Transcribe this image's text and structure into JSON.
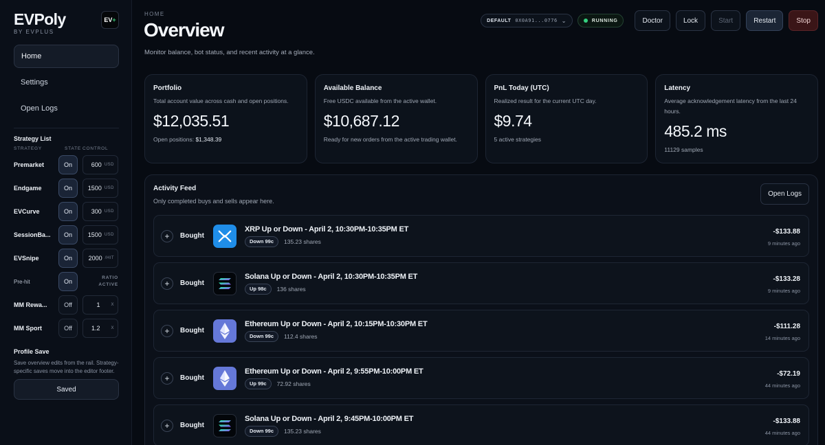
{
  "brand": {
    "title": "EVPoly",
    "subtitle": "BY EVPLUS",
    "logo_text": "EV",
    "logo_accent": "+"
  },
  "nav": [
    {
      "label": "Home",
      "active": true
    },
    {
      "label": "Settings",
      "active": false
    },
    {
      "label": "Open Logs",
      "active": false
    }
  ],
  "strategy_list": {
    "title": "Strategy List",
    "col_strategy": "STRATEGY",
    "col_state": "STATE",
    "col_control": "CONTROL",
    "rows": [
      {
        "name": "Premarket",
        "state": "On",
        "value": "600",
        "unit": "USD"
      },
      {
        "name": "Endgame",
        "state": "On",
        "value": "1500",
        "unit": "USD"
      },
      {
        "name": "EVCurve",
        "state": "On",
        "value": "300",
        "unit": "USD"
      },
      {
        "name": "SessionBa...",
        "state": "On",
        "value": "1500",
        "unit": "USD"
      },
      {
        "name": "EVSnipe",
        "state": "On",
        "value": "2000",
        "unit": "/HIT"
      },
      {
        "name": "Pre-hit",
        "state": "On",
        "ratio_label": "RATIO ACTIVE"
      },
      {
        "name": "MM Rewa...",
        "state": "Off",
        "value": "1",
        "unit": "X"
      },
      {
        "name": "MM Sport",
        "state": "Off",
        "value": "1.2",
        "unit": "X"
      }
    ]
  },
  "profile_save": {
    "title": "Profile Save",
    "description": "Save overview edits from the rail. Strategy-specific saves move into the editor footer.",
    "button": "Saved"
  },
  "header": {
    "breadcrumb": "HOME",
    "title": "Overview",
    "subtitle": "Monitor balance, bot status, and recent activity at a glance.",
    "profile_name": "DEFAULT",
    "profile_address": "0X0A91...0776",
    "status": "RUNNING",
    "buttons": {
      "doctor": "Doctor",
      "lock": "Lock",
      "start": "Start",
      "restart": "Restart",
      "stop": "Stop"
    }
  },
  "cards": {
    "portfolio": {
      "title": "Portfolio",
      "desc": "Total account value across cash and open positions.",
      "value": "$12,035.51",
      "foot_label": "Open positions:",
      "foot_value": "$1,348.39"
    },
    "balance": {
      "title": "Available Balance",
      "desc": "Free USDC available from the active wallet.",
      "value": "$10,687.12",
      "foot": "Ready for new orders from the active trading wallet."
    },
    "pnl": {
      "title": "PnL Today (UTC)",
      "desc": "Realized result for the current UTC day.",
      "value": "$9.74",
      "foot": "5 active strategies"
    },
    "latency": {
      "title": "Latency",
      "desc": "Average acknowledgement latency from the last 24 hours.",
      "value": "485.2 ms",
      "foot": "11129 samples"
    }
  },
  "feed": {
    "title": "Activity Feed",
    "subtitle": "Only completed buys and sells appear here.",
    "open_logs": "Open Logs",
    "items": [
      {
        "action": "Bought",
        "token": "xrp",
        "market": "XRP Up or Down - April 2, 10:30PM-10:35PM ET",
        "side": "Down 99c",
        "shares": "135.23 shares",
        "amount": "-$133.88",
        "time": "9 minutes ago"
      },
      {
        "action": "Bought",
        "token": "sol",
        "market": "Solana Up or Down - April 2, 10:30PM-10:35PM ET",
        "side": "Up 98c",
        "shares": "136 shares",
        "amount": "-$133.28",
        "time": "9 minutes ago"
      },
      {
        "action": "Bought",
        "token": "eth",
        "market": "Ethereum Up or Down - April 2, 10:15PM-10:30PM ET",
        "side": "Down 99c",
        "shares": "112.4 shares",
        "amount": "-$111.28",
        "time": "14 minutes ago"
      },
      {
        "action": "Bought",
        "token": "eth",
        "market": "Ethereum Up or Down - April 2, 9:55PM-10:00PM ET",
        "side": "Up 99c",
        "shares": "72.92 shares",
        "amount": "-$72.19",
        "time": "44 minutes ago"
      },
      {
        "action": "Bought",
        "token": "sol",
        "market": "Solana Up or Down - April 2, 9:45PM-10:00PM ET",
        "side": "Down 99c",
        "shares": "135.23 shares",
        "amount": "-$133.88",
        "time": "44 minutes ago"
      }
    ]
  },
  "colors": {
    "background": "#070b12",
    "running": "#35d07f",
    "danger": "#3a1517",
    "xrp": "#1f8de8",
    "eth": "#6578d8"
  }
}
